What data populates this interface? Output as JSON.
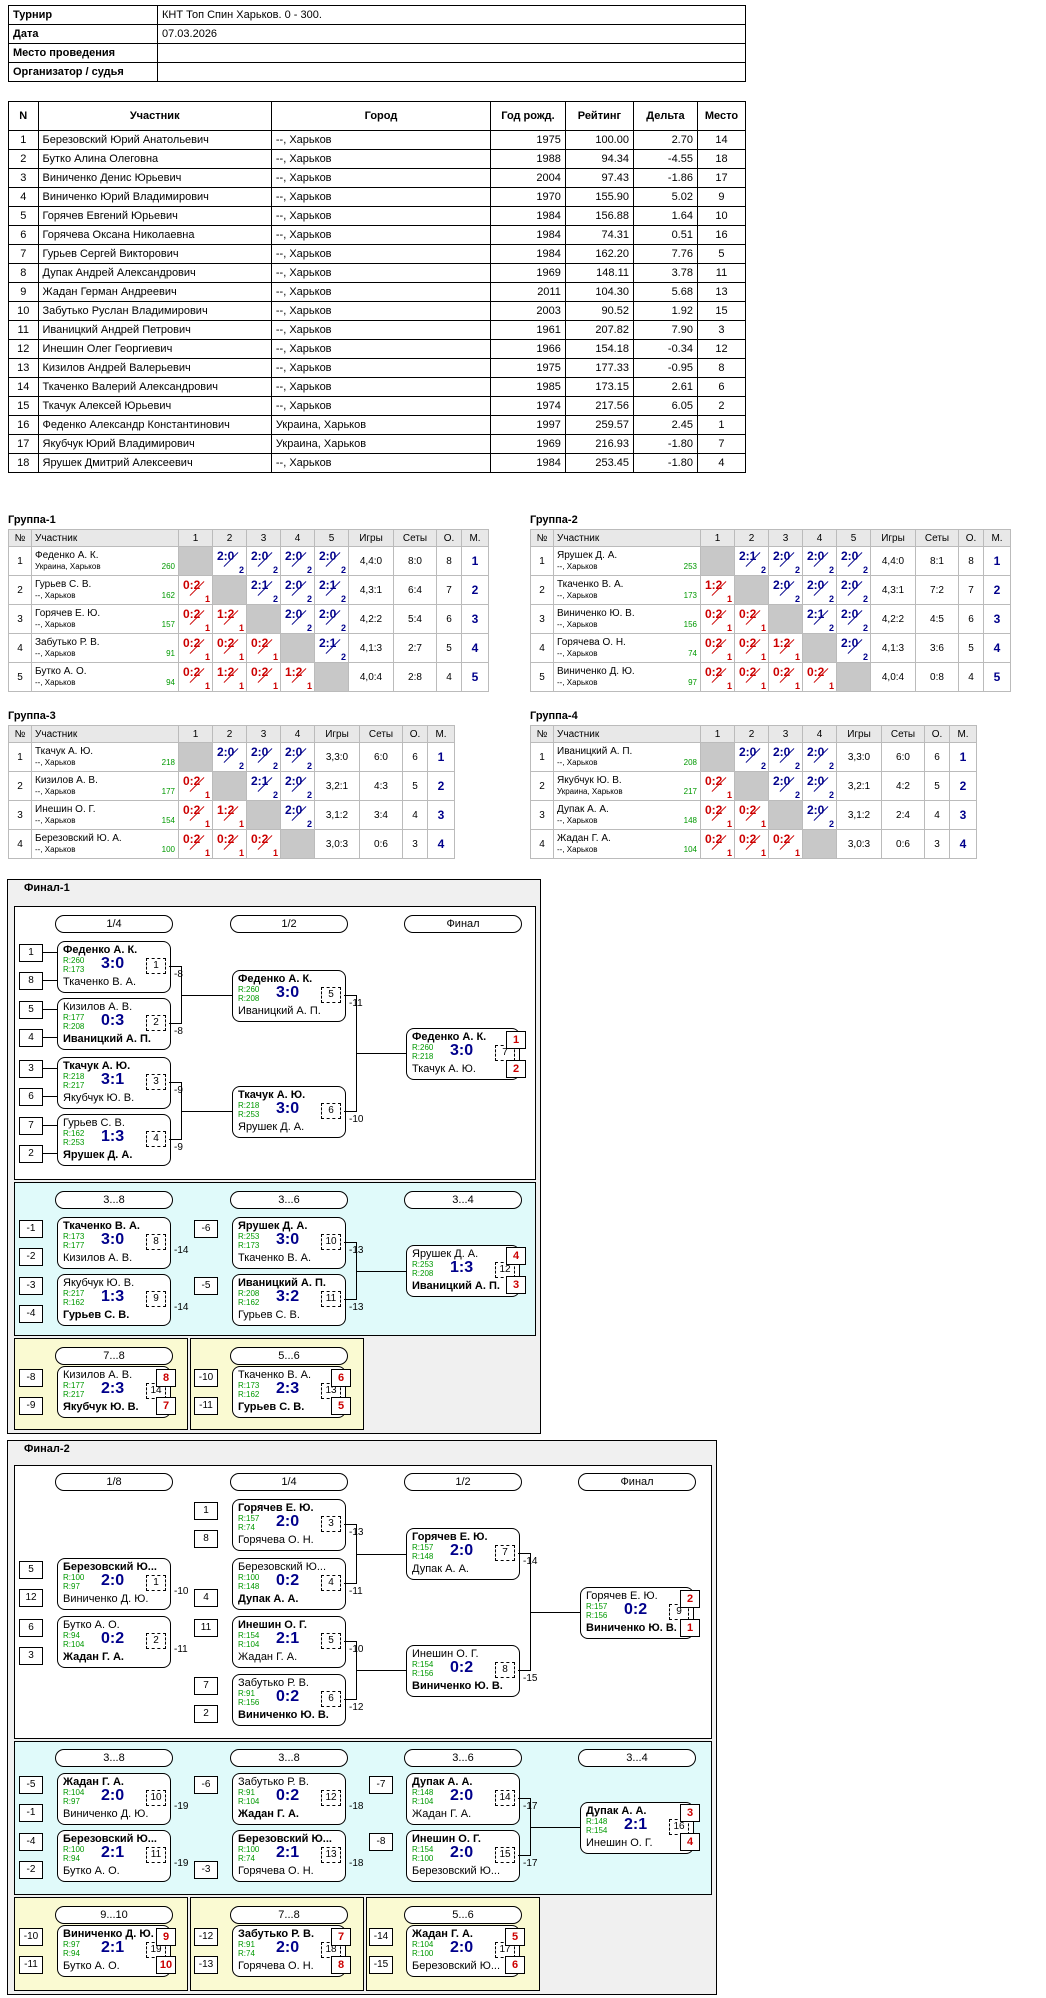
{
  "info": [
    {
      "k": "Турнир",
      "v": "КНТ Топ Спин Харьков. 0 - 300."
    },
    {
      "k": "Дата",
      "v": "07.03.2026"
    },
    {
      "k": "Место проведения",
      "v": ""
    },
    {
      "k": "Организатор / судья",
      "v": ""
    }
  ],
  "participants_headers": [
    "N",
    "Участник",
    "Город",
    "Год рожд.",
    "Рейтинг",
    "Дельта",
    "Место"
  ],
  "participants": [
    [
      "1",
      "Березовский Юрий Анатольевич",
      "--, Харьков",
      "1975",
      "100.00",
      "2.70",
      "14"
    ],
    [
      "2",
      "Бутко Алина Олеговна",
      "--, Харьков",
      "1988",
      "94.34",
      "-4.55",
      "18"
    ],
    [
      "3",
      "Виниченко Денис Юрьевич",
      "--, Харьков",
      "2004",
      "97.43",
      "-1.86",
      "17"
    ],
    [
      "4",
      "Виниченко Юрий Владимирович",
      "--, Харьков",
      "1970",
      "155.90",
      "5.02",
      "9"
    ],
    [
      "5",
      "Горячев Евгений Юрьевич",
      "--, Харьков",
      "1984",
      "156.88",
      "1.64",
      "10"
    ],
    [
      "6",
      "Горячева Оксана Николаевна",
      "--, Харьков",
      "1984",
      "74.31",
      "0.51",
      "16"
    ],
    [
      "7",
      "Гурьев Сергей Викторович",
      "--, Харьков",
      "1984",
      "162.20",
      "7.76",
      "5"
    ],
    [
      "8",
      "Дупак Андрей Александрович",
      "--, Харьков",
      "1969",
      "148.11",
      "3.78",
      "11"
    ],
    [
      "9",
      "Жадан Герман Андреевич",
      "--, Харьков",
      "2011",
      "104.30",
      "5.68",
      "13"
    ],
    [
      "10",
      "Забутько Руслан Владимирович",
      "--, Харьков",
      "2003",
      "90.52",
      "1.92",
      "15"
    ],
    [
      "11",
      "Иваницкий Андрей Петрович",
      "--, Харьков",
      "1961",
      "207.82",
      "7.90",
      "3"
    ],
    [
      "12",
      "Инешин Олег Георгиевич",
      "--, Харьков",
      "1966",
      "154.18",
      "-0.34",
      "12"
    ],
    [
      "13",
      "Кизилов Андрей Валерьевич",
      "--, Харьков",
      "1975",
      "177.33",
      "-0.95",
      "8"
    ],
    [
      "14",
      "Ткаченко Валерий Александрович",
      "--, Харьков",
      "1985",
      "173.15",
      "2.61",
      "6"
    ],
    [
      "15",
      "Ткачук Алексей Юрьевич",
      "--, Харьков",
      "1974",
      "217.56",
      "6.05",
      "2"
    ],
    [
      "16",
      "Феденко Александр Константинович",
      "Украина, Харьков",
      "1997",
      "259.57",
      "2.45",
      "1"
    ],
    [
      "17",
      "Якубчук Юрий Владимирович",
      "Украина, Харьков",
      "1969",
      "216.93",
      "-1.80",
      "7"
    ],
    [
      "18",
      "Ярушек Дмитрий Алексеевич",
      "--, Харьков",
      "1984",
      "253.45",
      "-1.80",
      "4"
    ]
  ],
  "groups": [
    {
      "title": "Группа-1",
      "n": 5,
      "rows": [
        {
          "name": "Феденко А. К.",
          "city": "Украина, Харьков",
          "r": "260",
          "s": [
            "",
            "2:0/2",
            "2:0/2",
            "2:0/2",
            "2:0/2"
          ],
          "games": "4,4:0",
          "sets": "8:0",
          "o": "8",
          "m": "1"
        },
        {
          "name": "Гурьев С. В.",
          "city": "--, Харьков",
          "r": "162",
          "s": [
            "0:2/1",
            "",
            "2:1/2",
            "2:0/2",
            "2:1/2"
          ],
          "games": "4,3:1",
          "sets": "6:4",
          "o": "7",
          "m": "2"
        },
        {
          "name": "Горячев Е. Ю.",
          "city": "--, Харьков",
          "r": "157",
          "s": [
            "0:2/1",
            "1:2/1",
            "",
            "2:0/2",
            "2:0/2"
          ],
          "games": "4,2:2",
          "sets": "5:4",
          "o": "6",
          "m": "3"
        },
        {
          "name": "Забутько Р. В.",
          "city": "--, Харьков",
          "r": "91",
          "s": [
            "0:2/1",
            "0:2/1",
            "0:2/1",
            "",
            "2:1/2"
          ],
          "games": "4,1:3",
          "sets": "2:7",
          "o": "5",
          "m": "4"
        },
        {
          "name": "Бутко А. О.",
          "city": "--, Харьков",
          "r": "94",
          "s": [
            "0:2/1",
            "1:2/1",
            "0:2/1",
            "1:2/1",
            ""
          ],
          "games": "4,0:4",
          "sets": "2:8",
          "o": "4",
          "m": "5"
        }
      ]
    },
    {
      "title": "Группа-2",
      "n": 5,
      "rows": [
        {
          "name": "Ярушек Д. А.",
          "city": "--, Харьков",
          "r": "253",
          "s": [
            "",
            "2:1/2",
            "2:0/2",
            "2:0/2",
            "2:0/2"
          ],
          "games": "4,4:0",
          "sets": "8:1",
          "o": "8",
          "m": "1"
        },
        {
          "name": "Ткаченко В. А.",
          "city": "--, Харьков",
          "r": "173",
          "s": [
            "1:2/1",
            "",
            "2:0/2",
            "2:0/2",
            "2:0/2"
          ],
          "games": "4,3:1",
          "sets": "7:2",
          "o": "7",
          "m": "2"
        },
        {
          "name": "Виниченко Ю. В.",
          "city": "--, Харьков",
          "r": "156",
          "s": [
            "0:2/1",
            "0:2/1",
            "",
            "2:1/2",
            "2:0/2"
          ],
          "games": "4,2:2",
          "sets": "4:5",
          "o": "6",
          "m": "3"
        },
        {
          "name": "Горячева О. Н.",
          "city": "--, Харьков",
          "r": "74",
          "s": [
            "0:2/1",
            "0:2/1",
            "1:2/1",
            "",
            "2:0/2"
          ],
          "games": "4,1:3",
          "sets": "3:6",
          "o": "5",
          "m": "4"
        },
        {
          "name": "Виниченко Д. Ю.",
          "city": "--, Харьков",
          "r": "97",
          "s": [
            "0:2/1",
            "0:2/1",
            "0:2/1",
            "0:2/1",
            ""
          ],
          "games": "4,0:4",
          "sets": "0:8",
          "o": "4",
          "m": "5"
        }
      ]
    },
    {
      "title": "Группа-3",
      "n": 4,
      "rows": [
        {
          "name": "Ткачук А. Ю.",
          "city": "--, Харьков",
          "r": "218",
          "s": [
            "",
            "2:0/2",
            "2:0/2",
            "2:0/2"
          ],
          "games": "3,3:0",
          "sets": "6:0",
          "o": "6",
          "m": "1"
        },
        {
          "name": "Кизилов А. В.",
          "city": "--, Харьков",
          "r": "177",
          "s": [
            "0:2/1",
            "",
            "2:1/2",
            "2:0/2"
          ],
          "games": "3,2:1",
          "sets": "4:3",
          "o": "5",
          "m": "2"
        },
        {
          "name": "Инешин О. Г.",
          "city": "--, Харьков",
          "r": "154",
          "s": [
            "0:2/1",
            "1:2/1",
            "",
            "2:0/2"
          ],
          "games": "3,1:2",
          "sets": "3:4",
          "o": "4",
          "m": "3"
        },
        {
          "name": "Березовский Ю. А.",
          "city": "--, Харьков",
          "r": "100",
          "s": [
            "0:2/1",
            "0:2/1",
            "0:2/1",
            ""
          ],
          "games": "3,0:3",
          "sets": "0:6",
          "o": "3",
          "m": "4"
        }
      ]
    },
    {
      "title": "Группа-4",
      "n": 4,
      "rows": [
        {
          "name": "Иваницкий А. П.",
          "city": "--, Харьков",
          "r": "208",
          "s": [
            "",
            "2:0/2",
            "2:0/2",
            "2:0/2"
          ],
          "games": "3,3:0",
          "sets": "6:0",
          "o": "6",
          "m": "1"
        },
        {
          "name": "Якубчук Ю. В.",
          "city": "Украина, Харьков",
          "r": "217",
          "s": [
            "0:2/1",
            "",
            "2:0/2",
            "2:0/2"
          ],
          "games": "3,2:1",
          "sets": "4:2",
          "o": "5",
          "m": "2"
        },
        {
          "name": "Дупак А. А.",
          "city": "--, Харьков",
          "r": "148",
          "s": [
            "0:2/1",
            "0:2/1",
            "",
            "2:0/2"
          ],
          "games": "3,1:2",
          "sets": "2:4",
          "o": "4",
          "m": "3"
        },
        {
          "name": "Жадан Г. А.",
          "city": "--, Харьков",
          "r": "104",
          "s": [
            "0:2/1",
            "0:2/1",
            "0:2/1",
            ""
          ],
          "games": "3,0:3",
          "sets": "0:6",
          "o": "3",
          "m": "4"
        }
      ]
    }
  ],
  "group_headers": {
    "no": "№",
    "part": "Участник",
    "games": "Игры",
    "sets": "Сеты",
    "o": "О.",
    "m": "М."
  },
  "final1": {
    "title": "Финал-1",
    "rounds": [
      "1/4",
      "1/2",
      "Финал",
      "3...8",
      "3...6",
      "3...4",
      "7...8",
      "5...6"
    ],
    "matches": [
      {
        "n1": "Феденко А. К.",
        "r1": "R:260",
        "n2": "Ткаченко В. А.",
        "r2": "R:173",
        "score": "3:0",
        "mno": "1",
        "w": 1,
        "dest": "-8"
      },
      {
        "n1": "Кизилов А. В.",
        "r1": "R:177",
        "n2": "Иваницкий А. П.",
        "r2": "R:208",
        "score": "0:3",
        "mno": "2",
        "w": 2,
        "dest": "-8"
      },
      {
        "n1": "Ткачук А. Ю.",
        "r1": "R:218",
        "n2": "Якубчук Ю. В.",
        "r2": "R:217",
        "score": "3:1",
        "mno": "3",
        "w": 1,
        "dest": "-9"
      },
      {
        "n1": "Гурьев С. В.",
        "r1": "R:162",
        "n2": "Ярушек Д. А.",
        "r2": "R:253",
        "score": "1:3",
        "mno": "4",
        "w": 2,
        "dest": "-9"
      },
      {
        "n1": "Феденко А. К.",
        "r1": "R:260",
        "n2": "Иваницкий А. П.",
        "r2": "R:208",
        "score": "3:0",
        "mno": "5",
        "w": 1,
        "dest": "-11"
      },
      {
        "n1": "Ткачук А. Ю.",
        "r1": "R:218",
        "n2": "Ярушек Д. А.",
        "r2": "R:253",
        "score": "3:0",
        "mno": "6",
        "w": 1,
        "dest": "-10"
      },
      {
        "n1": "Феденко А. К.",
        "r1": "R:260",
        "n2": "Ткачук А. Ю.",
        "r2": "R:218",
        "score": "3:0",
        "mno": "7",
        "w": 1,
        "dest": ""
      },
      {
        "n1": "Ткаченко В. А.",
        "r1": "R:173",
        "n2": "Кизилов А. В.",
        "r2": "R:177",
        "score": "3:0",
        "mno": "8",
        "w": 1,
        "dest": "-14"
      },
      {
        "n1": "Якубчук Ю. В.",
        "r1": "R:217",
        "n2": "Гурьев С. В.",
        "r2": "R:162",
        "score": "1:3",
        "mno": "9",
        "w": 2,
        "dest": "-14"
      },
      {
        "n1": "Ярушек Д. А.",
        "r1": "R:253",
        "n2": "Ткаченко В. А.",
        "r2": "R:173",
        "score": "3:0",
        "mno": "10",
        "w": 1,
        "dest": "-13"
      },
      {
        "n1": "Иваницкий А. П.",
        "r1": "R:208",
        "n2": "Гурьев С. В.",
        "r2": "R:162",
        "score": "3:2",
        "mno": "11",
        "w": 1,
        "dest": "-13"
      },
      {
        "n1": "Ярушек Д. А.",
        "r1": "R:253",
        "n2": "Иваницкий А. П.",
        "r2": "R:208",
        "score": "1:3",
        "mno": "12",
        "w": 2,
        "dest": ""
      },
      {
        "n1": "Кизилов А. В.",
        "r1": "R:177",
        "n2": "Якубчук Ю. В.",
        "r2": "R:217",
        "score": "2:3",
        "mno": "14",
        "w": 2,
        "dest": ""
      },
      {
        "n1": "Ткаченко В. А.",
        "r1": "R:173",
        "n2": "Гурьев С. В.",
        "r2": "R:162",
        "score": "2:3",
        "mno": "13",
        "w": 2,
        "dest": ""
      }
    ],
    "seeds": [
      "1",
      "8",
      "5",
      "4",
      "3",
      "6",
      "7",
      "2",
      "-1",
      "-2",
      "-3",
      "-4",
      "-6",
      "-5",
      "-8",
      "-9",
      "-10",
      "-11"
    ],
    "places": [
      "1",
      "2",
      "4",
      "3",
      "8",
      "7",
      "6",
      "5"
    ]
  },
  "final2": {
    "title": "Финал-2",
    "rounds": [
      "1/8",
      "1/4",
      "1/2",
      "Финал",
      "3...8",
      "3...8",
      "3...6",
      "3...4",
      "9...10",
      "7...8",
      "5...6"
    ],
    "matches": [
      {
        "n1": "Березовский Ю...",
        "r1": "R:100",
        "n2": "Виниченко Д. Ю.",
        "r2": "R:97",
        "score": "2:0",
        "mno": "1",
        "w": 1,
        "dest": "-10"
      },
      {
        "n1": "Бутко А. О.",
        "r1": "R:94",
        "n2": "Жадан Г. А.",
        "r2": "R:104",
        "score": "0:2",
        "mno": "2",
        "w": 2,
        "dest": "-11"
      },
      {
        "n1": "Горячев Е. Ю.",
        "r1": "R:157",
        "n2": "Горячева О. Н.",
        "r2": "R:74",
        "score": "2:0",
        "mno": "3",
        "w": 1,
        "dest": "-13"
      },
      {
        "n1": "Березовский Ю...",
        "r1": "R:100",
        "n2": "Дупак А. А.",
        "r2": "R:148",
        "score": "0:2",
        "mno": "4",
        "w": 2,
        "dest": "-11"
      },
      {
        "n1": "Инешин О. Г.",
        "r1": "R:154",
        "n2": "Жадан Г. А.",
        "r2": "R:104",
        "score": "2:1",
        "mno": "5",
        "w": 1,
        "dest": "-10"
      },
      {
        "n1": "Забутько Р. В.",
        "r1": "R:91",
        "n2": "Виниченко Ю. В.",
        "r2": "R:156",
        "score": "0:2",
        "mno": "6",
        "w": 2,
        "dest": "-12"
      },
      {
        "n1": "Горячев Е. Ю.",
        "r1": "R:157",
        "n2": "Дупак А. А.",
        "r2": "R:148",
        "score": "2:0",
        "mno": "7",
        "w": 1,
        "dest": "-14"
      },
      {
        "n1": "Инешин О. Г.",
        "r1": "R:154",
        "n2": "Виниченко Ю. В.",
        "r2": "R:156",
        "score": "0:2",
        "mno": "8",
        "w": 2,
        "dest": "-15"
      },
      {
        "n1": "Горячев Е. Ю.",
        "r1": "R:157",
        "n2": "Виниченко Ю. В.",
        "r2": "R:156",
        "score": "0:2",
        "mno": "9",
        "w": 2,
        "dest": ""
      },
      {
        "n1": "Жадан Г. А.",
        "r1": "R:104",
        "n2": "Виниченко Д. Ю.",
        "r2": "R:97",
        "score": "2:0",
        "mno": "10",
        "w": 1,
        "dest": "-19"
      },
      {
        "n1": "Березовский Ю...",
        "r1": "R:100",
        "n2": "Бутко А. О.",
        "r2": "R:94",
        "score": "2:1",
        "mno": "11",
        "w": 1,
        "dest": "-19"
      },
      {
        "n1": "Забутько Р. В.",
        "r1": "R:91",
        "n2": "Жадан Г. А.",
        "r2": "R:104",
        "score": "0:2",
        "mno": "12",
        "w": 2,
        "dest": "-18"
      },
      {
        "n1": "Березовский Ю...",
        "r1": "R:100",
        "n2": "Горячева О. Н.",
        "r2": "R:74",
        "score": "2:1",
        "mno": "13",
        "w": 1,
        "dest": "-18"
      },
      {
        "n1": "Дупак А. А.",
        "r1": "R:148",
        "n2": "Жадан Г. А.",
        "r2": "R:104",
        "score": "2:0",
        "mno": "14",
        "w": 1,
        "dest": "-17"
      },
      {
        "n1": "Инешин О. Г.",
        "r1": "R:154",
        "n2": "Березовский Ю...",
        "r2": "R:100",
        "score": "2:0",
        "mno": "15",
        "w": 1,
        "dest": "-17"
      },
      {
        "n1": "Дупак А. А.",
        "r1": "R:148",
        "n2": "Инешин О. Г.",
        "r2": "R:154",
        "score": "2:1",
        "mno": "16",
        "w": 1,
        "dest": ""
      },
      {
        "n1": "Виниченко Д. Ю.",
        "r1": "R:97",
        "n2": "Бутко А. О.",
        "r2": "R:94",
        "score": "2:1",
        "mno": "19",
        "w": 1,
        "dest": ""
      },
      {
        "n1": "Забутько Р. В.",
        "r1": "R:91",
        "n2": "Горячева О. Н.",
        "r2": "R:74",
        "score": "2:0",
        "mno": "18",
        "w": 1,
        "dest": ""
      },
      {
        "n1": "Жадан Г. А.",
        "r1": "R:104",
        "n2": "Березовский Ю...",
        "r2": "R:100",
        "score": "2:0",
        "mno": "17",
        "w": 1,
        "dest": ""
      }
    ],
    "seeds": [
      "1",
      "8",
      "5",
      "12",
      "4",
      "11",
      "6",
      "3",
      "7",
      "2",
      "-5",
      "-1",
      "-6",
      "-4",
      "-2",
      "-3",
      "-7",
      "-8",
      "-10",
      "-11",
      "-12",
      "-13",
      "-14",
      "-15"
    ],
    "places": [
      "2",
      "1",
      "3",
      "4",
      "9",
      "10",
      "7",
      "8",
      "5",
      "6"
    ]
  }
}
